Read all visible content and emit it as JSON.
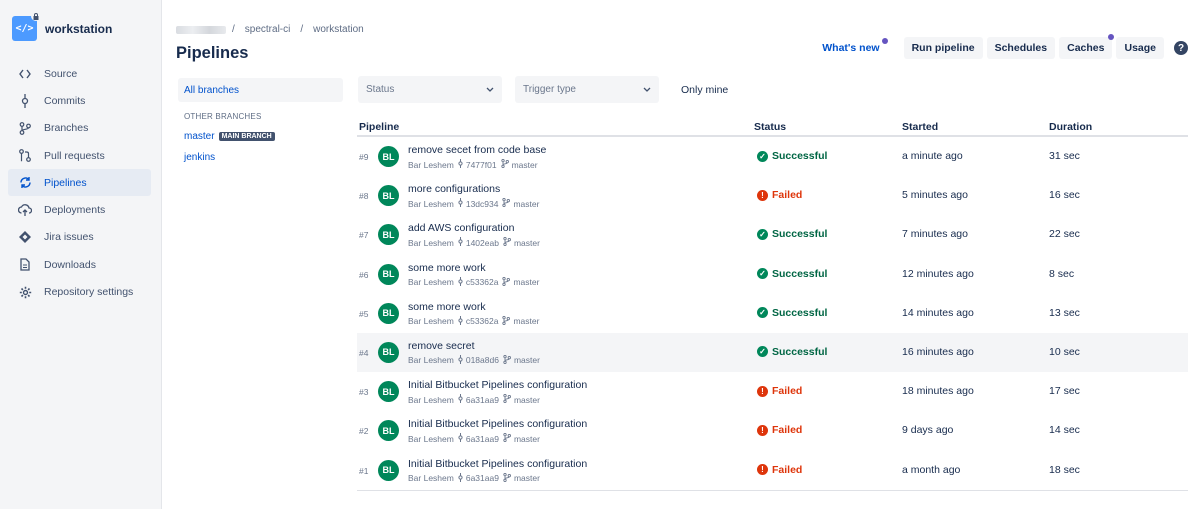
{
  "repo": {
    "name": "workstation",
    "avatar_glyph": "</>"
  },
  "nav": [
    {
      "label": "Source",
      "icon": "code-icon"
    },
    {
      "label": "Commits",
      "icon": "commit-icon"
    },
    {
      "label": "Branches",
      "icon": "branch-icon"
    },
    {
      "label": "Pull requests",
      "icon": "pull-request-icon"
    },
    {
      "label": "Pipelines",
      "icon": "pipelines-icon",
      "active": true
    },
    {
      "label": "Deployments",
      "icon": "deployments-icon"
    },
    {
      "label": "Jira issues",
      "icon": "jira-icon"
    },
    {
      "label": "Downloads",
      "icon": "downloads-icon"
    },
    {
      "label": "Repository settings",
      "icon": "gear-icon"
    }
  ],
  "breadcrumb": {
    "project": "spectral-ci",
    "repo": "workstation",
    "sep": "/"
  },
  "page_title": "Pipelines",
  "actions": {
    "whats_new": "What's new",
    "run_pipeline": "Run pipeline",
    "schedules": "Schedules",
    "caches": "Caches",
    "usage": "Usage",
    "help": "?",
    "dot_color": "#6554c0"
  },
  "branches": {
    "all": "All branches",
    "group_label": "OTHER BRANCHES",
    "items": [
      {
        "name": "master",
        "badge": "MAIN BRANCH"
      },
      {
        "name": "jenkins",
        "badge": ""
      }
    ]
  },
  "filters": {
    "status": "Status",
    "trigger": "Trigger type",
    "only_mine": "Only mine"
  },
  "table": {
    "headers": {
      "pipeline": "Pipeline",
      "status": "Status",
      "started": "Started",
      "duration": "Duration"
    },
    "rows": [
      {
        "num": "#9",
        "initials": "BL",
        "title": "remove secet from code base",
        "author": "Bar Leshem",
        "commit": "7477f01",
        "branch": "master",
        "status": "Successful",
        "ok": true,
        "started": "a minute ago",
        "duration": "31 sec"
      },
      {
        "num": "#8",
        "initials": "BL",
        "title": "more configurations",
        "author": "Bar Leshem",
        "commit": "13dc934",
        "branch": "master",
        "status": "Failed",
        "ok": false,
        "started": "5 minutes ago",
        "duration": "16 sec"
      },
      {
        "num": "#7",
        "initials": "BL",
        "title": "add AWS configuration",
        "author": "Bar Leshem",
        "commit": "1402eab",
        "branch": "master",
        "status": "Successful",
        "ok": true,
        "started": "7 minutes ago",
        "duration": "22 sec"
      },
      {
        "num": "#6",
        "initials": "BL",
        "title": "some more work",
        "author": "Bar Leshem",
        "commit": "c53362a",
        "branch": "master",
        "status": "Successful",
        "ok": true,
        "started": "12 minutes ago",
        "duration": "8 sec"
      },
      {
        "num": "#5",
        "initials": "BL",
        "title": "some more work",
        "author": "Bar Leshem",
        "commit": "c53362a",
        "branch": "master",
        "status": "Successful",
        "ok": true,
        "started": "14 minutes ago",
        "duration": "13 sec"
      },
      {
        "num": "#4",
        "initials": "BL",
        "title": "remove secret",
        "author": "Bar Leshem",
        "commit": "018a8d6",
        "branch": "master",
        "status": "Successful",
        "ok": true,
        "started": "16 minutes ago",
        "duration": "10 sec",
        "highlighted": true
      },
      {
        "num": "#3",
        "initials": "BL",
        "title": "Initial Bitbucket Pipelines configuration",
        "author": "Bar Leshem",
        "commit": "6a31aa9",
        "branch": "master",
        "status": "Failed",
        "ok": false,
        "started": "18 minutes ago",
        "duration": "17 sec"
      },
      {
        "num": "#2",
        "initials": "BL",
        "title": "Initial Bitbucket Pipelines configuration",
        "author": "Bar Leshem",
        "commit": "6a31aa9",
        "branch": "master",
        "status": "Failed",
        "ok": false,
        "started": "9 days ago",
        "duration": "14 sec"
      },
      {
        "num": "#1",
        "initials": "BL",
        "title": "Initial Bitbucket Pipelines configuration",
        "author": "Bar Leshem",
        "commit": "6a31aa9",
        "branch": "master",
        "status": "Failed",
        "ok": false,
        "started": "a month ago",
        "duration": "18 sec"
      }
    ]
  },
  "colors": {
    "accent": "#0052cc",
    "success": "#00875a",
    "failed": "#de350b"
  }
}
